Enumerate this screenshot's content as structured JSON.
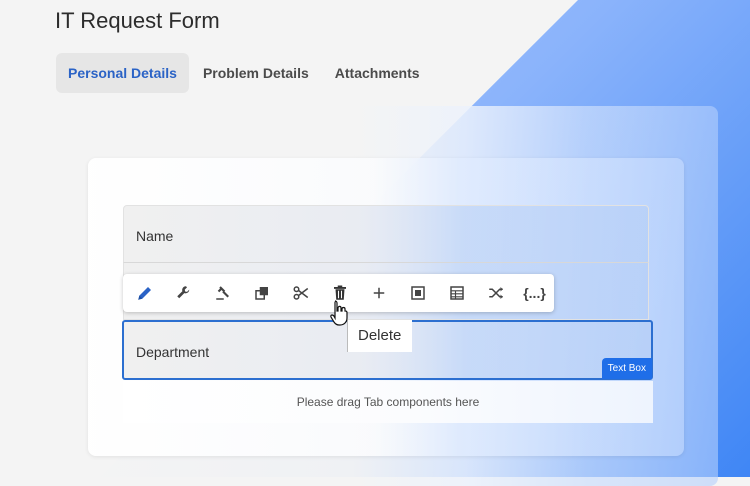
{
  "page": {
    "title": "IT Request Form"
  },
  "tabs": [
    {
      "label": "Personal Details",
      "active": true
    },
    {
      "label": "Problem Details",
      "active": false
    },
    {
      "label": "Attachments",
      "active": false
    }
  ],
  "form": {
    "fields": [
      {
        "label": "Name"
      },
      {
        "label": ""
      },
      {
        "label": "Department",
        "selected": true,
        "badge": "Text Box"
      }
    ],
    "dropzone_text": "Please drag Tab components here"
  },
  "toolbar": {
    "buttons": [
      {
        "icon": "pencil-icon"
      },
      {
        "icon": "wrench-icon"
      },
      {
        "icon": "gavel-icon"
      },
      {
        "icon": "copy-icon"
      },
      {
        "icon": "scissors-icon"
      },
      {
        "icon": "trash-icon"
      },
      {
        "icon": "plus-icon"
      },
      {
        "icon": "wrap-panel-icon"
      },
      {
        "icon": "table-icon"
      },
      {
        "icon": "shuffle-icon"
      },
      {
        "icon": "code-braces-icon",
        "text": "{...}"
      }
    ],
    "tooltip": "Delete"
  },
  "colors": {
    "accent": "#2b63c6",
    "selection_border": "#2c6fd0",
    "badge_bg": "#1f6ee8"
  }
}
